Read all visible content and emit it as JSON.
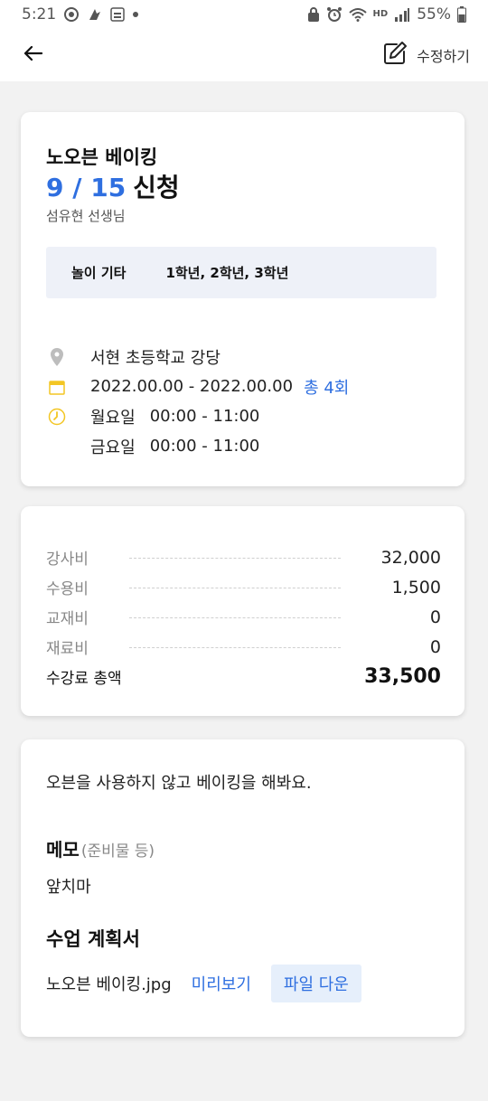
{
  "status_bar": {
    "time": "5:21",
    "battery": "55%",
    "hd_label": "HD"
  },
  "app_bar": {
    "edit_label": "수정하기"
  },
  "class_card": {
    "title": "노오븐 베이킹",
    "applied_count": "9 / 15",
    "applied_label": "신청",
    "teacher": "섬유현 선생님",
    "category": "놀이 기타",
    "grades": "1학년, 2학년, 3학년",
    "location": "서현 초등학교 강당",
    "period": "2022.00.00 - 2022.00.00",
    "total_sessions": "총 4회",
    "schedule": [
      {
        "day": "월요일",
        "time": "00:00 - 11:00"
      },
      {
        "day": "금요일",
        "time": "00:00 - 11:00"
      }
    ]
  },
  "fee_card": {
    "rows": [
      {
        "label": "강사비",
        "value": "32,000"
      },
      {
        "label": "수용비",
        "value": "1,500"
      },
      {
        "label": "교재비",
        "value": "0"
      },
      {
        "label": "재료비",
        "value": "0"
      }
    ],
    "total_label": "수강료 총액",
    "total_value": "33,500"
  },
  "detail_card": {
    "description": "오븐을 사용하지 않고 베이킹을 해봐요.",
    "memo_title": "메모",
    "memo_sub": "(준비물 등)",
    "memo_text": "앞치마",
    "plan_title": "수업 계획서",
    "file_name": "노오븐 베이킹.jpg",
    "preview_label": "미리보기",
    "download_label": "파일 다운"
  },
  "colors": {
    "accent": "#2f6fe0",
    "tag_bg": "#eef1f8",
    "download_bg": "#e6effb",
    "page_bg": "#f2f2f2"
  }
}
